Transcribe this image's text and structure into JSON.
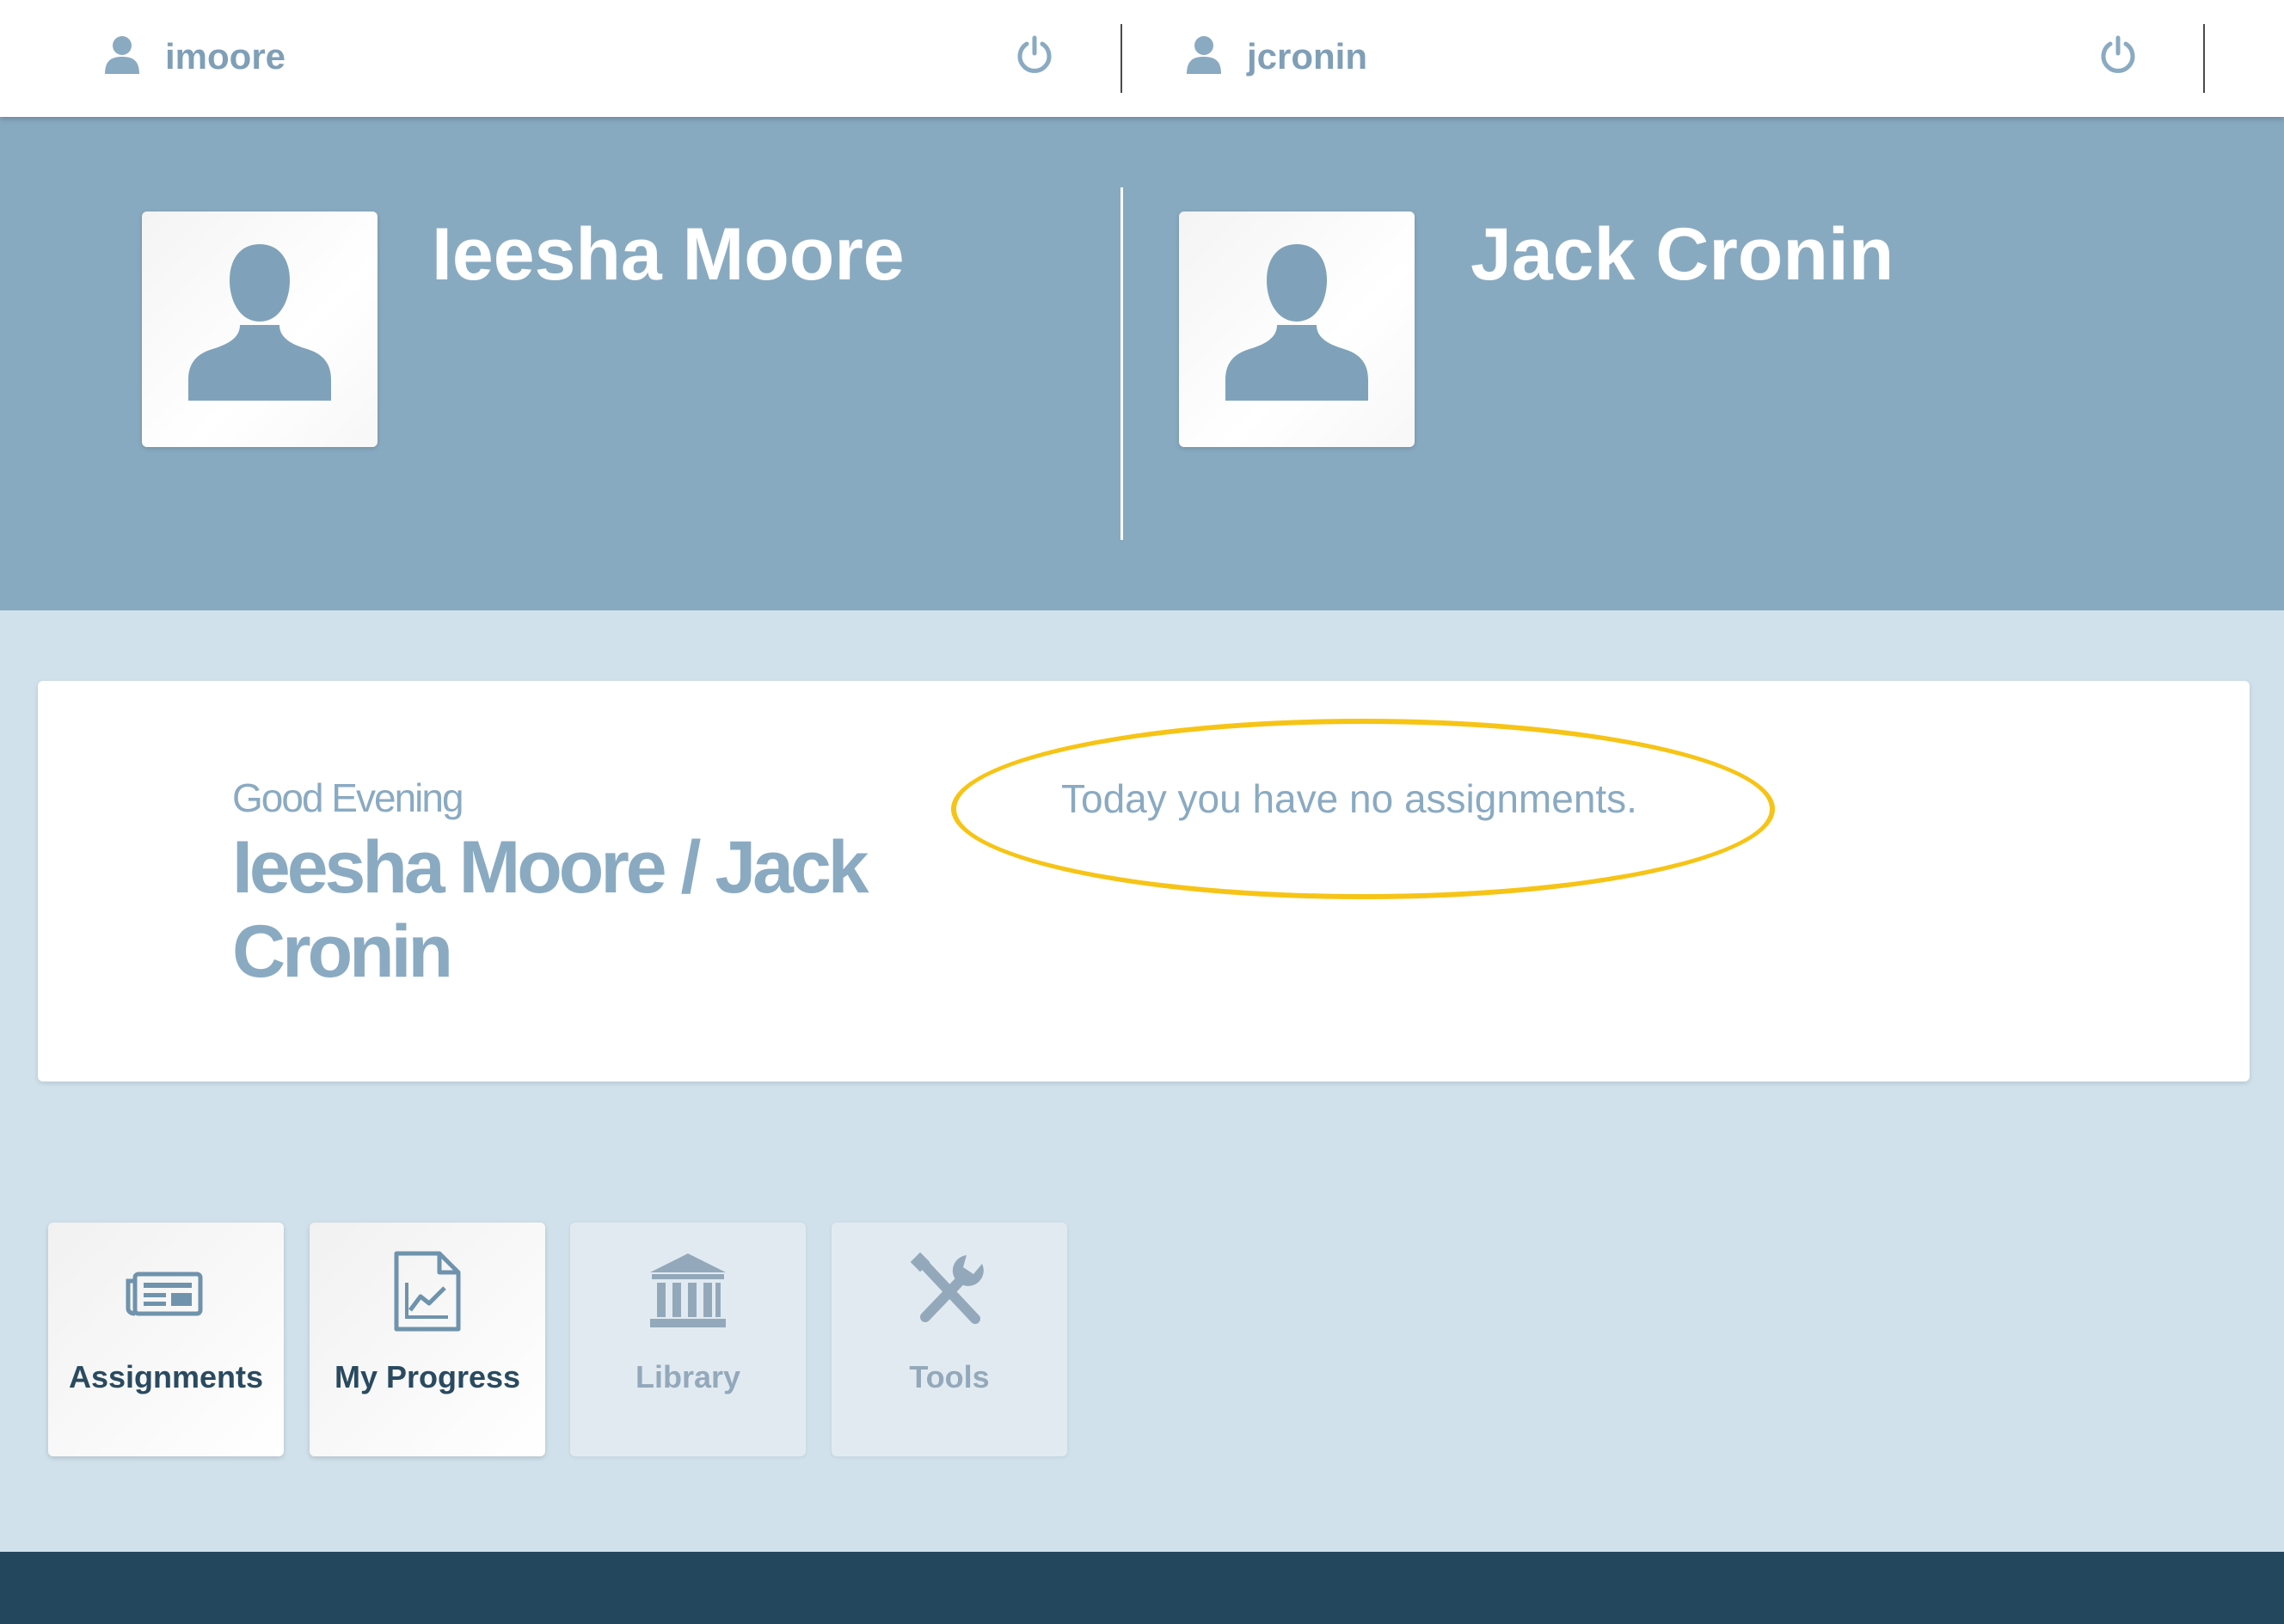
{
  "theme": {
    "accent": "#88aac1",
    "text_muted": "#8aaac2",
    "highlight": "#f6c416",
    "footer": "#23475d"
  },
  "sessions": [
    {
      "username": "imoore",
      "user_icon": "user-icon",
      "power_icon": "power-icon"
    },
    {
      "username": "jcronin",
      "user_icon": "user-icon",
      "power_icon": "power-icon"
    }
  ],
  "profiles": [
    {
      "name": "Ieesha Moore",
      "avatar_icon": "person-silhouette-icon"
    },
    {
      "name": "Jack Cronin",
      "avatar_icon": "person-silhouette-icon"
    }
  ],
  "greeting": {
    "salutation": "Good Evening",
    "names": "Ieesha Moore / Jack Cronin",
    "message": "Today you have no assignments."
  },
  "tiles": [
    {
      "label": "Assignments",
      "icon": "newspaper-icon",
      "state": "active"
    },
    {
      "label": "My Progress",
      "icon": "chart-document-icon",
      "state": "active"
    },
    {
      "label": "Library",
      "icon": "library-icon",
      "state": "disabled"
    },
    {
      "label": "Tools",
      "icon": "tools-icon",
      "state": "disabled"
    }
  ]
}
